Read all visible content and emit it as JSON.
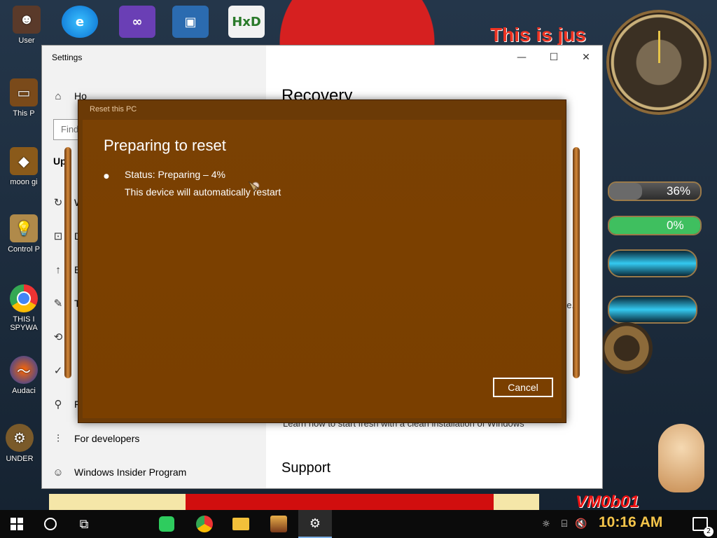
{
  "desktop": {
    "left_icons": [
      {
        "label": "User",
        "icon": "user-folder-icon"
      },
      {
        "label": "This P",
        "icon": "this-pc-icon"
      },
      {
        "label": "moon gi",
        "icon": "bucket-icon"
      },
      {
        "label": "Control P",
        "icon": "lightbulb-icon"
      },
      {
        "label": "THIS I SPYWA",
        "icon": "chrome-icon"
      },
      {
        "label": "Audaci",
        "icon": "audacity-icon"
      },
      {
        "label": "UNDER",
        "icon": "gear-shortcut-icon"
      }
    ],
    "top_icons": [
      {
        "label": "",
        "icon": "edge-icon"
      },
      {
        "label": "",
        "icon": "visual-studio-icon"
      },
      {
        "label": "",
        "icon": "virtualbox-icon"
      },
      {
        "label": "",
        "icon": "hxd-icon"
      }
    ],
    "banner_text": "This is jus",
    "gauges": [
      {
        "label": "36%",
        "value": 36,
        "color": "#5a5a5a"
      },
      {
        "label": "0%",
        "value": 0,
        "color": "#3fbf5f"
      }
    ],
    "signature": "VM0b01"
  },
  "settings": {
    "window_title": "Settings",
    "search_placeholder": "Find",
    "sidebar": [
      {
        "label": "Ho",
        "icon": "home-icon"
      },
      {
        "label": "Up",
        "icon": ""
      },
      {
        "label": "W",
        "icon": "sync-icon"
      },
      {
        "label": "D",
        "icon": "delivery-icon"
      },
      {
        "label": "B",
        "icon": "backup-icon"
      },
      {
        "label": "T",
        "icon": "wrench-icon"
      },
      {
        "label": "",
        "icon": "recovery-icon"
      },
      {
        "label": "",
        "icon": "activation-icon"
      },
      {
        "label": "F",
        "icon": "find-device-icon"
      },
      {
        "label": "For developers",
        "icon": "developer-icon"
      },
      {
        "label": "Windows Insider Program",
        "icon": "insider-icon"
      }
    ],
    "page_title": "Recovery",
    "fresh_start_link": "Learn how to start fresh with a clean installation of Windows",
    "support_heading": "Support",
    "right_fragment_1": "e",
    "right_fragment_2": "ge."
  },
  "dialog": {
    "title": "Reset this PC",
    "heading": "Preparing to reset",
    "status": "Status: Preparing – 4%",
    "progress_percent": 4,
    "note": "This device will automatically restart",
    "cancel_label": "Cancel"
  },
  "taskbar": {
    "time": "10:16 AM",
    "notification_count": "2",
    "apps": [
      {
        "icon": "start-icon"
      },
      {
        "icon": "search-circle-icon"
      },
      {
        "icon": "task-view-icon"
      },
      {
        "icon": "chat-app-icon"
      },
      {
        "icon": "chrome-icon"
      },
      {
        "icon": "file-explorer-icon"
      },
      {
        "icon": "game-app-icon"
      },
      {
        "icon": "settings-gear-icon"
      }
    ]
  }
}
